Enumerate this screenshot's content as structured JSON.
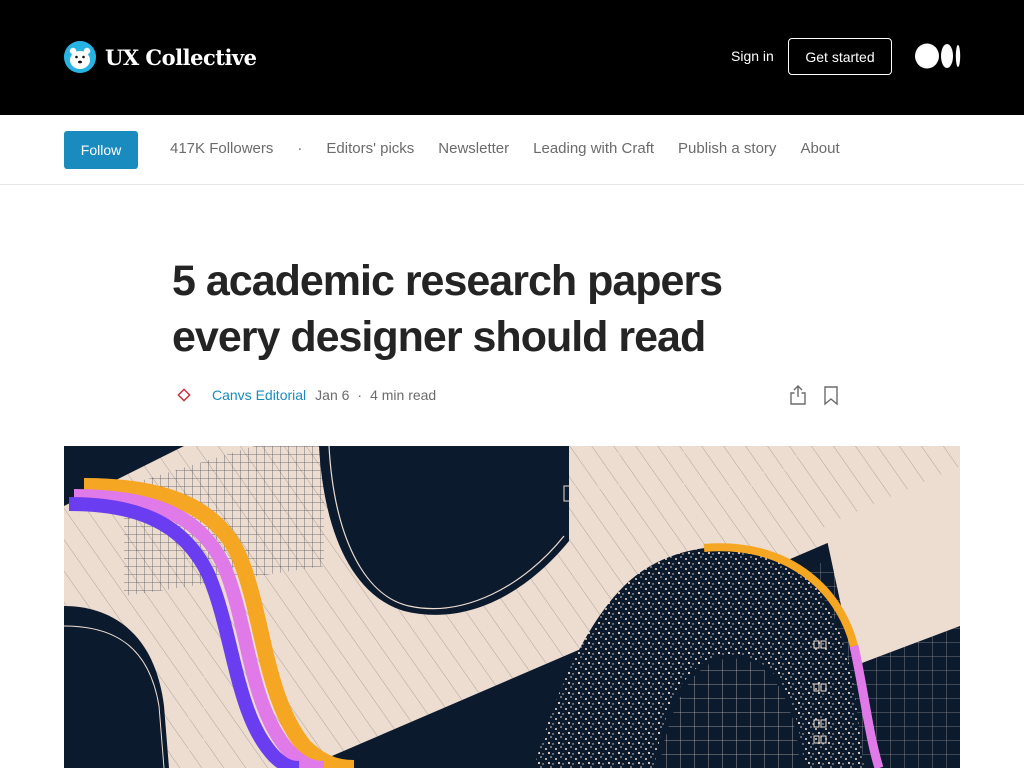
{
  "header": {
    "brand_name": "UX Collective",
    "brand_logo_icon": "polar-bear-icon",
    "signin_label": "Sign in",
    "get_started_label": "Get started",
    "medium_icon": "medium-logo-icon",
    "colors": {
      "background": "#000000",
      "text": "#ffffff",
      "logo_bg": "#27b4e3"
    }
  },
  "publication": {
    "follow_label": "Follow",
    "followers": "417K Followers",
    "separator": "·",
    "links": [
      "Editors' picks",
      "Newsletter",
      "Leading with Craft",
      "Publish a story",
      "About"
    ],
    "colors": {
      "follow_bg": "#1a8bbf",
      "link_text": "#6b6b6b"
    }
  },
  "article": {
    "title_line1": "5 academic research papers",
    "title_line2": "every designer should read",
    "author": "Canvs Editorial",
    "author_icon": "diamond-avatar-icon",
    "date": "Jan 6",
    "dot": "·",
    "read_time": "4 min read",
    "share_icon": "share-icon",
    "bookmark_icon": "bookmark-icon",
    "colors": {
      "author": "#1a8bbf",
      "title": "#242424"
    }
  },
  "hero": {
    "alt_icon": "abstract-illustration",
    "colors": {
      "navy": "#0c1a2e",
      "cream": "#eddcd0",
      "orange": "#f5a623",
      "purple": "#6b3df0",
      "pink": "#e07ae8"
    }
  }
}
